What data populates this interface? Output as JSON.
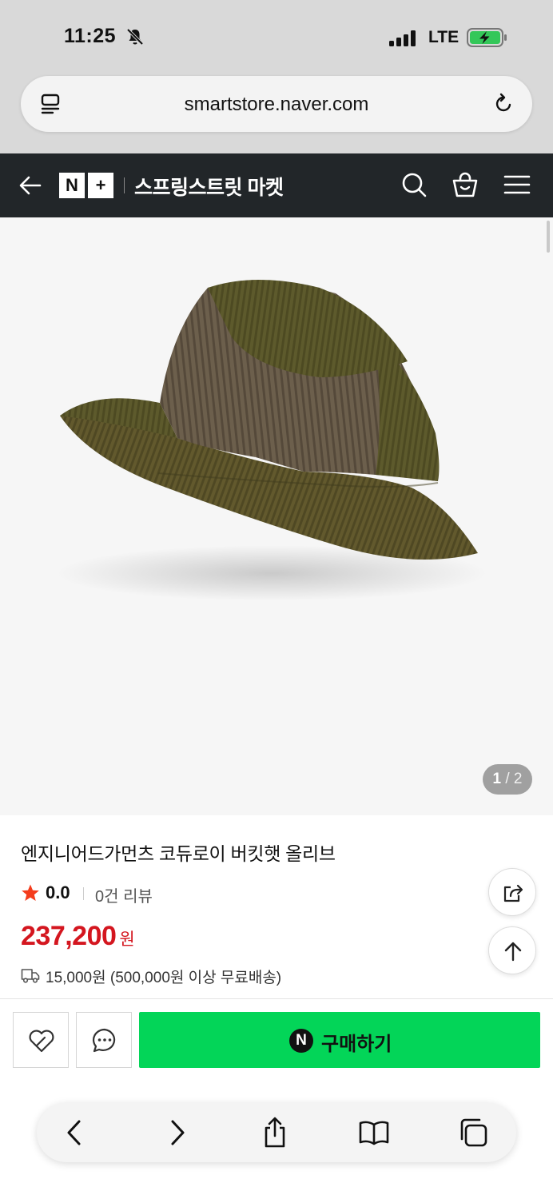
{
  "status_bar": {
    "time": "11:25",
    "network": "LTE",
    "icons": [
      "bell-slash-icon",
      "cellular-signal-icon",
      "battery-charging-icon"
    ]
  },
  "browser": {
    "url": "smartstore.naver.com",
    "icons": [
      "reader-mode-icon",
      "reload-icon"
    ]
  },
  "header": {
    "logo_n": "N",
    "logo_plus": "+",
    "store_name": "스프링스트릿 마켓",
    "icons": [
      "back-arrow-icon",
      "search-icon",
      "cart-icon",
      "hamburger-menu-icon"
    ]
  },
  "gallery": {
    "current": "1",
    "separator": "/",
    "total": "2"
  },
  "product": {
    "title": "엔지니어드가먼츠 코듀로이 버킷햇 올리브",
    "rating": "0.0",
    "review_count": "0건 리뷰",
    "price": "237,200",
    "price_unit": "원",
    "shipping": "15,000원 (500,000원 이상 무료배송)"
  },
  "actions": {
    "purchase_label": "구매하기",
    "npay_badge": "N",
    "icons": [
      "heart-icon",
      "talk-bubble-icon",
      "share-icon",
      "arrow-up-icon"
    ]
  },
  "safari_toolbar": {
    "icons": [
      "chevron-left-icon",
      "chevron-right-icon",
      "share-icon",
      "book-icon",
      "tabs-icon"
    ]
  },
  "colors": {
    "header_bg": "#222629",
    "price": "#d4161f",
    "purchase_button": "#03d558",
    "battery_charging": "#34c759"
  }
}
